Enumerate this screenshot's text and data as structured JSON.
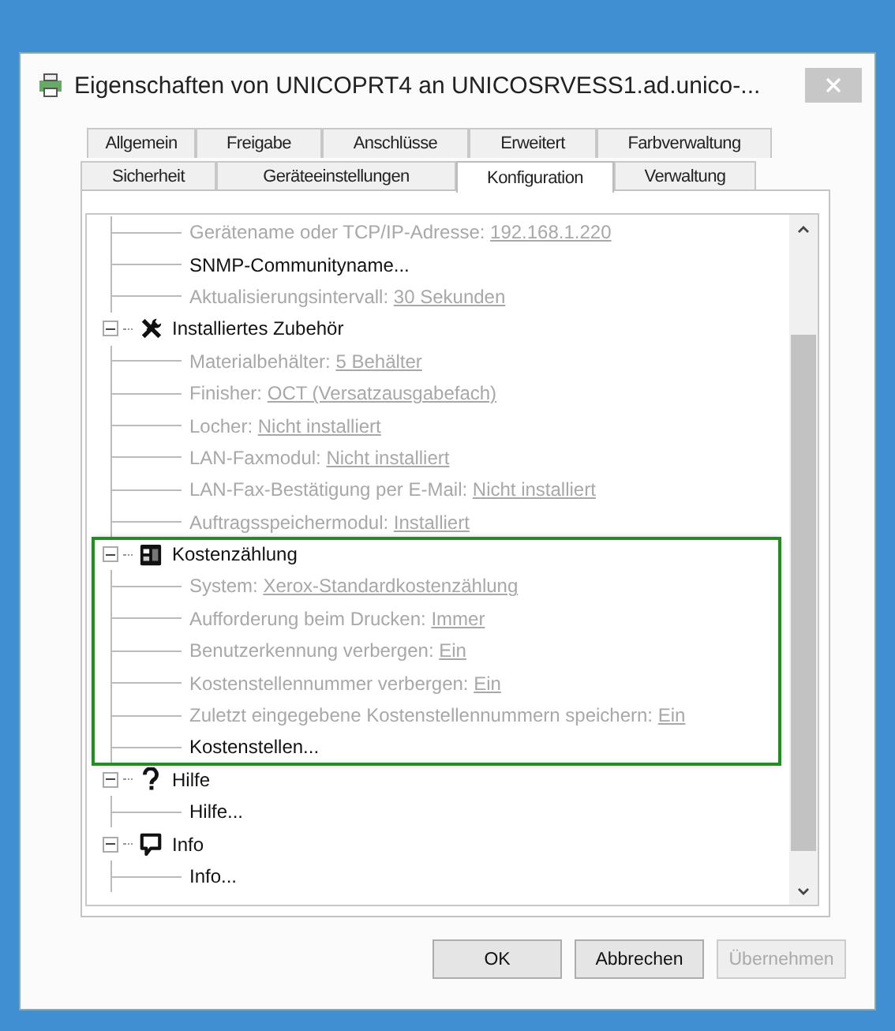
{
  "window": {
    "title": "Eigenschaften von UNICOPRT4 an UNICOSRVESS1.ad.unico-..."
  },
  "tab_rows": [
    [
      {
        "label": "Allgemein",
        "selected": false
      },
      {
        "label": "Freigabe",
        "selected": false
      },
      {
        "label": "Anschlüsse",
        "selected": false
      },
      {
        "label": "Erweitert",
        "selected": false
      },
      {
        "label": "Farbverwaltung",
        "selected": false
      }
    ],
    [
      {
        "label": "Sicherheit",
        "selected": false
      },
      {
        "label": "Geräteeinstellungen",
        "selected": false
      },
      {
        "label": "Konfiguration",
        "selected": true
      },
      {
        "label": "Verwaltung",
        "selected": false
      }
    ]
  ],
  "tree": [
    {
      "children": [
        {
          "kind": "setting",
          "label": "Gerätename oder TCP/IP-Adresse:",
          "value": "192.168.1.220"
        },
        {
          "kind": "action",
          "label": "SNMP-Communityname..."
        },
        {
          "kind": "setting",
          "label": "Aktualisierungsintervall:",
          "value": "30 Sekunden"
        }
      ]
    },
    {
      "label": "Installiertes Zubehör",
      "kind": "tools",
      "expanded": true,
      "children": [
        {
          "kind": "setting",
          "label": "Materialbehälter:",
          "value": "5 Behälter"
        },
        {
          "kind": "setting",
          "label": "Finisher:",
          "value": "OCT (Versatzausgabefach)"
        },
        {
          "kind": "setting",
          "label": "Locher:",
          "value": "Nicht installiert"
        },
        {
          "kind": "setting",
          "label": "LAN-Faxmodul:",
          "value": "Nicht installiert"
        },
        {
          "kind": "setting",
          "label": "LAN-Fax-Bestätigung per E-Mail:",
          "value": "Nicht installiert"
        },
        {
          "kind": "setting",
          "label": "Auftragsspeichermodul:",
          "value": "Installiert"
        }
      ]
    },
    {
      "label": "Kostenzählung",
      "kind": "accounting",
      "expanded": true,
      "highlighted": true,
      "children": [
        {
          "kind": "setting",
          "label": "System:",
          "value": "Xerox-Standardkostenzählung"
        },
        {
          "kind": "setting",
          "label": "Aufforderung beim Drucken:",
          "value": "Immer"
        },
        {
          "kind": "setting",
          "label": "Benutzerkennung verbergen:",
          "value": "Ein"
        },
        {
          "kind": "setting",
          "label": "Kostenstellennummer verbergen:",
          "value": "Ein"
        },
        {
          "kind": "setting",
          "label": "Zuletzt eingegebene Kostenstellennummern speichern:",
          "value": "Ein"
        },
        {
          "kind": "action",
          "label": "Kostenstellen..."
        }
      ]
    },
    {
      "label": "Hilfe",
      "kind": "help",
      "expanded": true,
      "children": [
        {
          "kind": "action",
          "label": "Hilfe..."
        }
      ]
    },
    {
      "label": "Info",
      "kind": "info",
      "expanded": true,
      "children": [
        {
          "kind": "action",
          "label": "Info..."
        }
      ]
    }
  ],
  "buttons": [
    {
      "label": "OK",
      "disabled": false
    },
    {
      "label": "Abbrechen",
      "disabled": false
    },
    {
      "label": "Übernehmen",
      "disabled": true
    }
  ]
}
